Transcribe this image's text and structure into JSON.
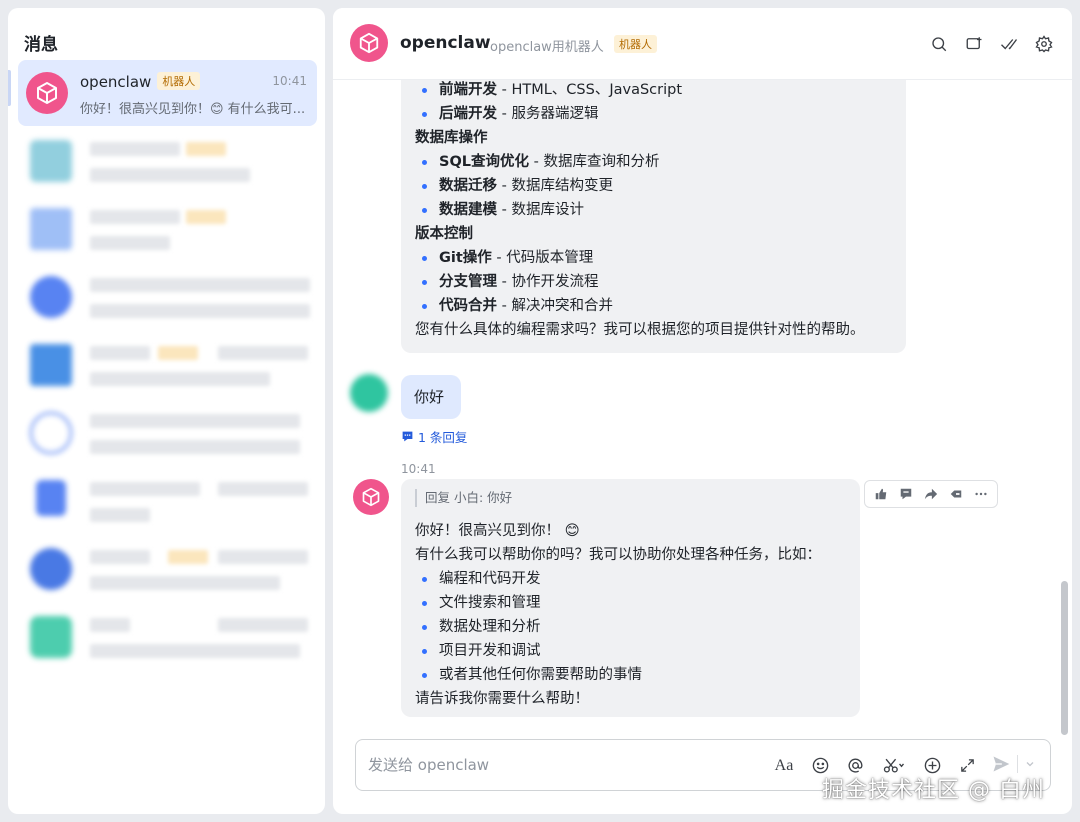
{
  "sidebar": {
    "title": "消息",
    "active_conversation": {
      "name": "openclaw",
      "tag": "机器人",
      "time": "10:41",
      "preview": "你好！很高兴见到你！😊 有什么我可..."
    }
  },
  "chat": {
    "header": {
      "name": "openclaw",
      "subtitle": "openclaw用机器人",
      "tag": "机器人"
    },
    "message1": {
      "lines": [
        {
          "type": "li",
          "bold": "前端开发",
          "rest": " - HTML、CSS、JavaScript"
        },
        {
          "type": "li",
          "bold": "后端开发",
          "rest": " - 服务器端逻辑"
        },
        {
          "type": "h",
          "bold": "数据库操作",
          "rest": ""
        },
        {
          "type": "li",
          "bold": "SQL查询优化",
          "rest": " - 数据库查询和分析"
        },
        {
          "type": "li",
          "bold": "数据迁移",
          "rest": " - 数据库结构变更"
        },
        {
          "type": "li",
          "bold": "数据建模",
          "rest": " - 数据库设计"
        },
        {
          "type": "h",
          "bold": "版本控制",
          "rest": ""
        },
        {
          "type": "li",
          "bold": "Git操作",
          "rest": " - 代码版本管理"
        },
        {
          "type": "li",
          "bold": "分支管理",
          "rest": " - 协作开发流程"
        },
        {
          "type": "li",
          "bold": "代码合并",
          "rest": " - 解决冲突和合并"
        },
        {
          "type": "p",
          "bold": "",
          "rest": "您有什么具体的编程需求吗？我可以根据您的项目提供针对性的帮助。"
        }
      ]
    },
    "message2": {
      "text": "你好",
      "reply_count": "1 条回复"
    },
    "message3": {
      "time": "10:41",
      "quote": "回复 小白: 你好",
      "lines": [
        {
          "type": "p",
          "rest": "你好！很高兴见到你！ 😊"
        },
        {
          "type": "p",
          "rest": "有什么我可以帮助你的吗？我可以协助你处理各种任务，比如："
        },
        {
          "type": "li",
          "rest": "编程和代码开发"
        },
        {
          "type": "li",
          "rest": "文件搜索和管理"
        },
        {
          "type": "li",
          "rest": "数据处理和分析"
        },
        {
          "type": "li",
          "rest": "项目开发和调试"
        },
        {
          "type": "li",
          "rest": "或者其他任何你需要帮助的事情"
        },
        {
          "type": "p",
          "rest": "请告诉我你需要什么帮助！"
        }
      ]
    },
    "input": {
      "placeholder": "发送给 openclaw",
      "format_label": "Aa"
    }
  },
  "watermark": "掘金技术社区 @ 白州",
  "colors": {
    "accent": "#3370ff",
    "robot_avatar": "#f0558c",
    "bot_tag_bg": "#fdf1d7",
    "bot_tag_text": "#b26a00",
    "active_item_bg": "#e1eaff"
  }
}
